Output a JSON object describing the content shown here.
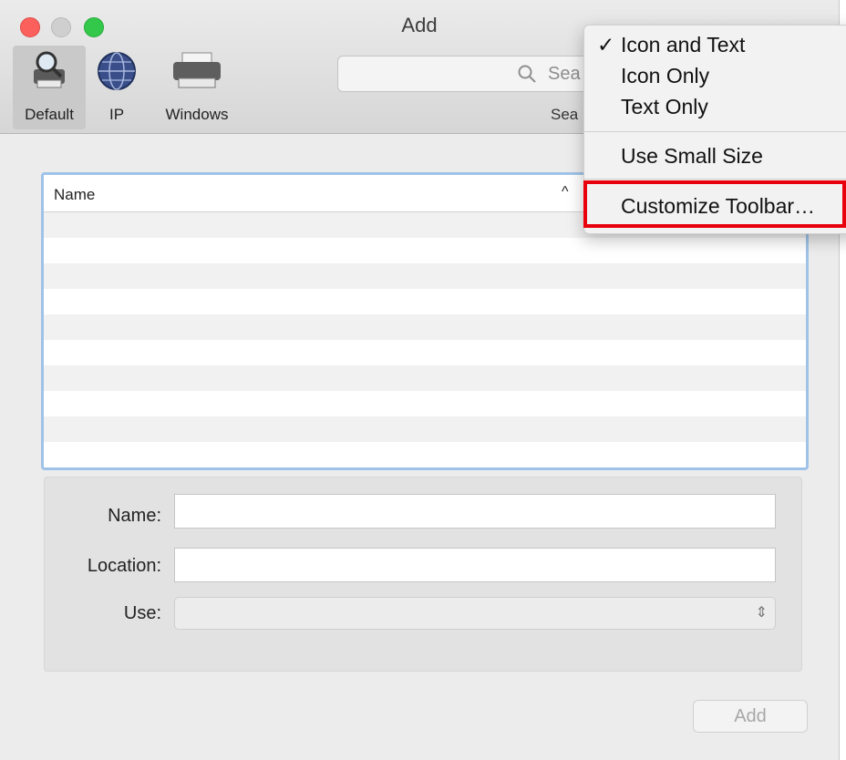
{
  "window": {
    "title": "Add"
  },
  "toolbar": {
    "items": [
      {
        "label": "Default",
        "icon": "printer-search-icon"
      },
      {
        "label": "IP",
        "icon": "globe-icon"
      },
      {
        "label": "Windows",
        "icon": "printer-icon"
      }
    ],
    "search": {
      "placeholder": "Sea",
      "label": "Sea"
    }
  },
  "list": {
    "column_name": "Name",
    "sort_indicator": "^"
  },
  "form": {
    "name_label": "Name:",
    "location_label": "Location:",
    "use_label": "Use:",
    "name_value": "",
    "location_value": "",
    "use_value": ""
  },
  "buttons": {
    "add": "Add"
  },
  "context_menu": {
    "items": [
      {
        "label": "Icon and Text",
        "checked": true
      },
      {
        "label": "Icon Only",
        "checked": false
      },
      {
        "label": "Text Only",
        "checked": false
      },
      {
        "label": "Use Small Size",
        "checked": false
      },
      {
        "label": "Customize Toolbar…",
        "checked": false
      }
    ],
    "check_mark": "✓",
    "highlight_color": "#e8000c"
  },
  "colors": {
    "close": "#fc605c",
    "zoom": "#34c84a",
    "selection_border": "#9fc3e8"
  }
}
